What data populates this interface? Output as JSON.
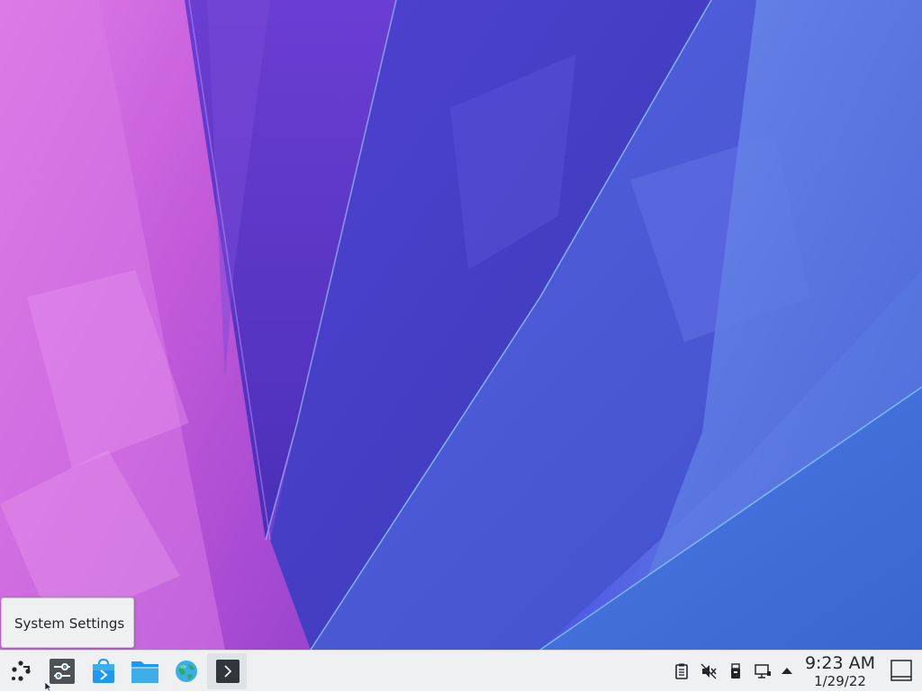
{
  "desktop": {
    "wallpaper": "abstract-polygon-fan",
    "colors": {
      "pink": "#d26fe0",
      "purple": "#5b3ccf",
      "blue": "#4a67e0"
    }
  },
  "tooltip": {
    "text": "System Settings"
  },
  "panel": {
    "launcher_icon": "application-launcher-icon",
    "tasks": [
      {
        "name": "System Settings",
        "icon": "system-settings-icon"
      },
      {
        "name": "Discover",
        "icon": "discover-icon"
      },
      {
        "name": "Dolphin",
        "icon": "folder-icon"
      },
      {
        "name": "Web Browser",
        "icon": "web-browser-icon"
      },
      {
        "name": "Konsole",
        "icon": "terminal-icon"
      }
    ],
    "tray": [
      {
        "icon": "clipboard-icon"
      },
      {
        "icon": "volume-muted-icon"
      },
      {
        "icon": "removable-device-icon"
      },
      {
        "icon": "network-wired-icon"
      },
      {
        "icon": "expand-tray-arrow-icon"
      }
    ],
    "clock": {
      "time": "9:23 AM",
      "date": "1/29/22"
    },
    "show_desktop_icon": "show-desktop-icon"
  }
}
